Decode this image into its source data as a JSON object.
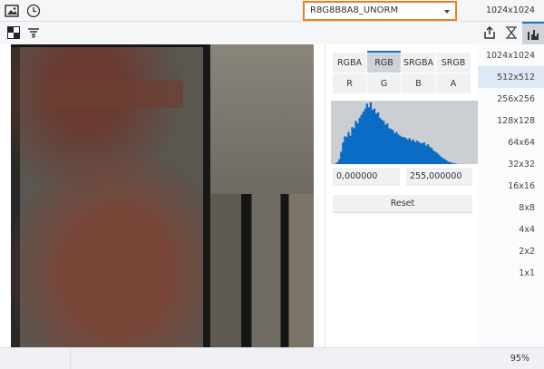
{
  "toolbar": {
    "icons": [
      "image-icon",
      "history-icon"
    ],
    "format": "R8G8B8A8_UNORM",
    "resolution": "1024x1024"
  },
  "toolbar2": {
    "icons": [
      "checkerboard-icon",
      "filter-icon"
    ]
  },
  "panel_tabs": {
    "icons": [
      "export-icon",
      "hourglass-icon",
      "histogram-icon"
    ]
  },
  "channels": {
    "modes": [
      "RGBA",
      "RGB",
      "SRGBA",
      "SRGB"
    ],
    "active_mode": "RGB",
    "channels": [
      "R",
      "G",
      "B",
      "A"
    ]
  },
  "range": {
    "min": "0,000000",
    "max": "255,000000",
    "reset_label": "Reset"
  },
  "mips": {
    "items": [
      "1024x1024",
      "512x512",
      "256x256",
      "128x128",
      "64x64",
      "32x32",
      "16x16",
      "8x8",
      "4x4",
      "2x2",
      "1x1"
    ],
    "active": "512x512"
  },
  "status": {
    "zoom": "95%"
  },
  "colors": {
    "accent": "#1a73c9",
    "highlight": "#f07d1e",
    "histogram": "#0a6cc4"
  },
  "chart_data": {
    "type": "bar",
    "title": "",
    "bins": [
      0,
      1,
      3,
      8,
      20,
      35,
      45,
      44,
      52,
      46,
      60,
      58,
      70,
      66,
      75,
      80,
      85,
      90,
      98,
      92,
      100,
      88,
      90,
      82,
      84,
      75,
      72,
      70,
      64,
      66,
      58,
      57,
      55,
      50,
      52,
      48,
      46,
      44,
      44,
      42,
      40,
      42,
      38,
      40,
      36,
      38,
      36,
      34,
      34,
      35,
      30,
      32,
      28,
      26,
      22,
      20,
      18,
      15,
      12,
      10,
      8,
      6,
      4,
      3,
      2,
      1,
      1,
      0,
      0,
      0,
      0,
      0,
      0,
      0,
      0,
      0,
      0,
      0,
      0,
      0
    ],
    "ylim": [
      0,
      100
    ]
  }
}
